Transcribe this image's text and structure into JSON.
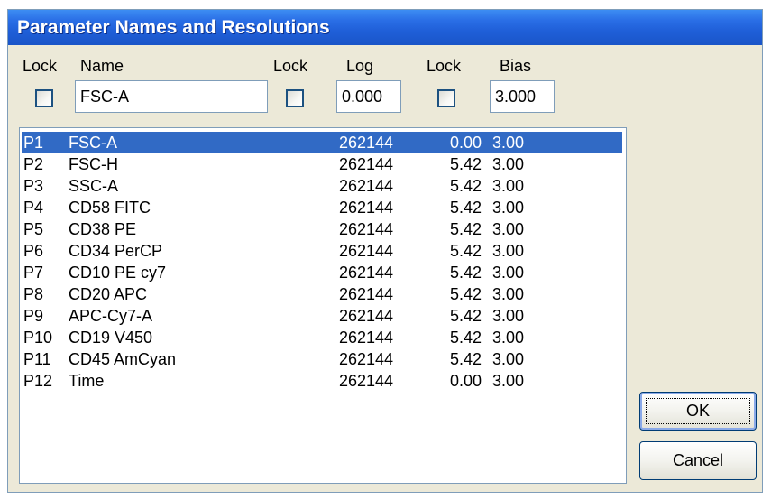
{
  "window": {
    "title": "Parameter Names and Resolutions"
  },
  "header": {
    "lock1_label": "Lock",
    "name_label": "Name",
    "lock2_label": "Lock",
    "log_label": "Log",
    "lock3_label": "Lock",
    "bias_label": "Bias"
  },
  "fields": {
    "name_value": "FSC-A",
    "log_value": "0.000",
    "bias_value": "3.000"
  },
  "parameters": [
    {
      "id": "P1",
      "name": "FSC-A",
      "resolution": "262144",
      "log": "0.00",
      "bias": "3.00",
      "selected": true
    },
    {
      "id": "P2",
      "name": "FSC-H",
      "resolution": "262144",
      "log": "5.42",
      "bias": "3.00",
      "selected": false
    },
    {
      "id": "P3",
      "name": "SSC-A",
      "resolution": "262144",
      "log": "5.42",
      "bias": "3.00",
      "selected": false
    },
    {
      "id": "P4",
      "name": "CD58 FITC",
      "resolution": "262144",
      "log": "5.42",
      "bias": "3.00",
      "selected": false
    },
    {
      "id": "P5",
      "name": "CD38 PE",
      "resolution": "262144",
      "log": "5.42",
      "bias": "3.00",
      "selected": false
    },
    {
      "id": "P6",
      "name": "CD34 PerCP",
      "resolution": "262144",
      "log": "5.42",
      "bias": "3.00",
      "selected": false
    },
    {
      "id": "P7",
      "name": "CD10 PE cy7",
      "resolution": "262144",
      "log": "5.42",
      "bias": "3.00",
      "selected": false
    },
    {
      "id": "P8",
      "name": "CD20 APC",
      "resolution": "262144",
      "log": "5.42",
      "bias": "3.00",
      "selected": false
    },
    {
      "id": "P9",
      "name": "APC-Cy7-A",
      "resolution": "262144",
      "log": "5.42",
      "bias": "3.00",
      "selected": false
    },
    {
      "id": "P10",
      "name": "CD19 V450",
      "resolution": "262144",
      "log": "5.42",
      "bias": "3.00",
      "selected": false
    },
    {
      "id": "P11",
      "name": "CD45 AmCyan",
      "resolution": "262144",
      "log": "5.42",
      "bias": "3.00",
      "selected": false
    },
    {
      "id": "P12",
      "name": "Time",
      "resolution": "262144",
      "log": "0.00",
      "bias": "3.00",
      "selected": false
    }
  ],
  "buttons": {
    "ok": "OK",
    "cancel": "Cancel"
  },
  "colors": {
    "titlebar": "#1f5fd8",
    "selection": "#316ac5",
    "dialog_bg": "#ece9d8"
  }
}
